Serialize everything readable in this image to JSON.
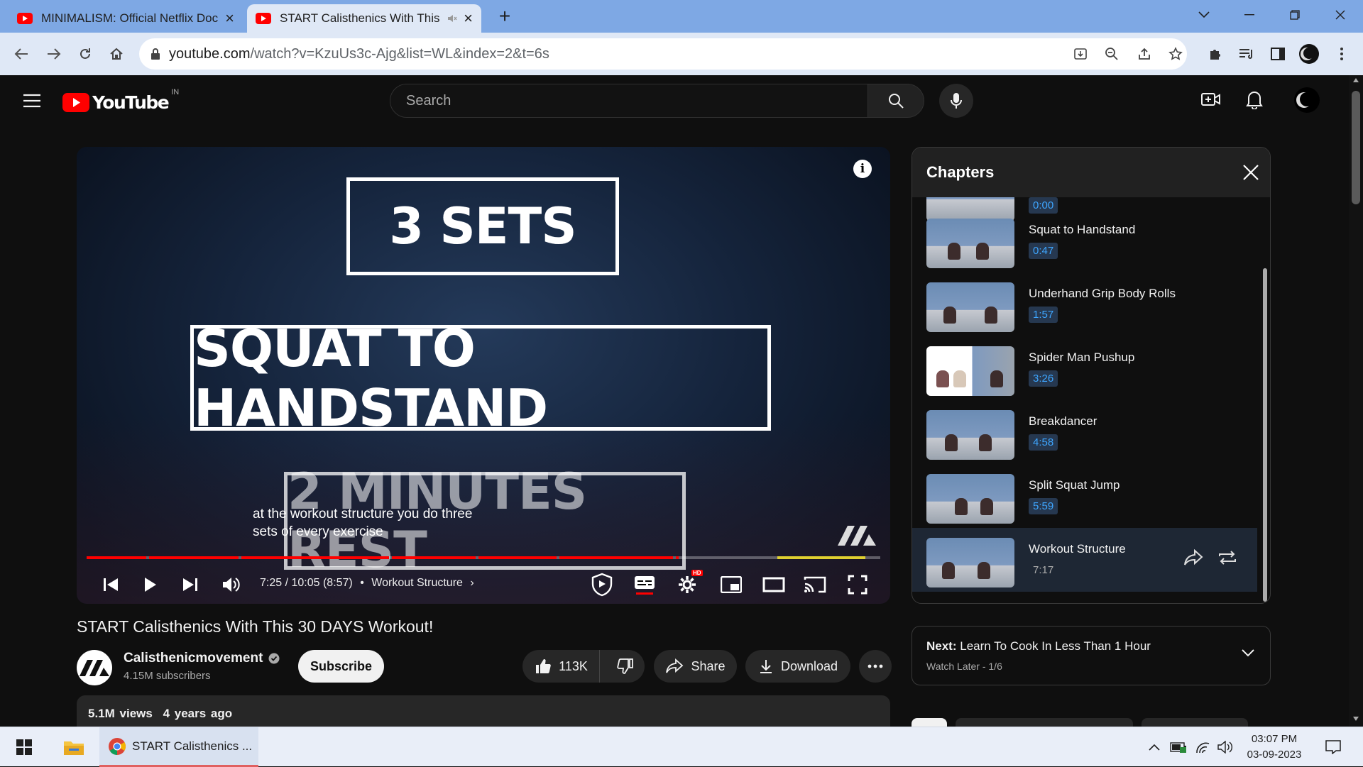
{
  "browser": {
    "tabs": [
      {
        "title": "MINIMALISM: Official Netflix Doc",
        "active": false
      },
      {
        "title": "START Calisthenics With This",
        "active": true
      }
    ],
    "url_host": "youtube.com",
    "url_path": "/watch?v=KzuUs3c-Ajg&list=WL&index=2&t=6s"
  },
  "youtube": {
    "logo_text": "YouTube",
    "region": "IN",
    "search_placeholder": "Search"
  },
  "player": {
    "overlay_sets": "3 SETS",
    "overlay_exercise": "SQUAT TO HANDSTAND",
    "overlay_rest": "2 MINUTES REST",
    "caption_line1": "at the workout structure you do three",
    "caption_line2": "sets of every exercise",
    "time": "7:25 / 10:05 (8:57)",
    "chapter": "Workout Structure",
    "progress_fraction": 0.7388,
    "hd_badge": "HD"
  },
  "chapters_panel": {
    "title": "Chapters",
    "items": [
      {
        "title": "",
        "time": "0:00",
        "current": false
      },
      {
        "title": "Squat to Handstand",
        "time": "0:47",
        "current": false
      },
      {
        "title": "Underhand Grip Body Rolls",
        "time": "1:57",
        "current": false
      },
      {
        "title": "Spider Man Pushup",
        "time": "3:26",
        "current": false
      },
      {
        "title": "Breakdancer",
        "time": "4:58",
        "current": false
      },
      {
        "title": "Split Squat Jump",
        "time": "5:59",
        "current": false
      },
      {
        "title": "Workout Structure",
        "time": "7:17",
        "current": true
      }
    ]
  },
  "video": {
    "title": "START Calisthenics With This 30 DAYS Workout!",
    "channel": "Calisthenicmovement",
    "subscribers": "4.15M subscribers",
    "subscribe_label": "Subscribe",
    "likes": "113K",
    "share_label": "Share",
    "download_label": "Download",
    "views": "5.1M views",
    "age": "4 years ago"
  },
  "next": {
    "label": "Next:",
    "title": "Learn To Cook In Less Than 1 Hour",
    "playlist": "Watch Later - 1/6"
  },
  "taskbar": {
    "app_label": "START Calisthenics ...",
    "time": "03:07 PM",
    "date": "03-09-2023"
  },
  "colors": {
    "accent_red": "#ff0000",
    "chapter_time_blue": "#3ea6ff",
    "browser_tabbar": "#7ea8e4"
  }
}
